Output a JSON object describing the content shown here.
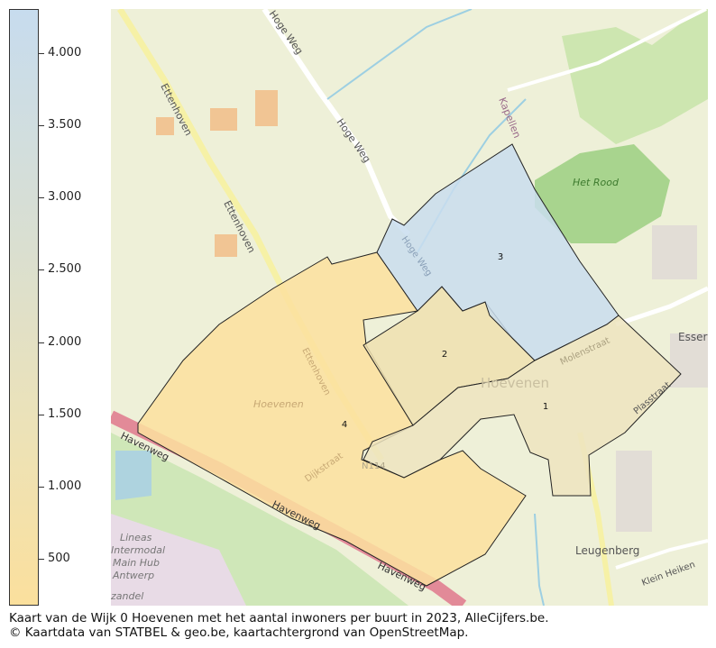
{
  "legend": {
    "colors": {
      "low": "#fbe09d",
      "mid": "#dadfd0",
      "high": "#c7dcee"
    },
    "ticks": [
      "4.000",
      "3.500",
      "3.000",
      "2.500",
      "2.000",
      "1.500",
      "1.000",
      "500"
    ]
  },
  "map": {
    "regions": [
      {
        "label": "1",
        "color": "#ede4c0"
      },
      {
        "label": "2",
        "color": "#efe0b0"
      },
      {
        "label": "3",
        "color": "#c9ddee"
      },
      {
        "label": "4",
        "color": "#fbe19f"
      }
    ],
    "street_labels": {
      "hoge_weg_top": "Hoge Weg",
      "hoge_weg_mid": "Hoge Weg",
      "hoge_weg_region": "Hoge Weg",
      "ettenhoven_1": "Ettenhoven",
      "ettenhoven_2": "Ettenhoven",
      "ettenhoven_3": "Ettenhoven",
      "kapellen": "Kapellen",
      "het_rood": "Het Rood",
      "esser": "Esser",
      "molenstraat": "Molenstraat",
      "plasstraat": "Plasstraat",
      "hoevenen_big": "Hoevenen",
      "hoevenen_small": "Hoevenen",
      "havenweg_1": "Havenweg",
      "havenweg_2": "Havenweg",
      "havenweg_3": "Havenweg",
      "dijkstraat": "Dijkstraat",
      "n114": "N114",
      "leugenberg": "Leugenberg",
      "klein_heiken": "Klein Heiken",
      "lineas": "Lineas",
      "intermodal": "Intermodal",
      "main_hub": "Main Hub",
      "antwerp": "Antwerp",
      "zandel": "zandel"
    }
  },
  "caption": {
    "line1": "Kaart van de Wijk 0 Hoevenen met het aantal inwoners per buurt in 2023, AlleCijfers.be.",
    "line2": "© Kaartdata van STATBEL & geo.be, kaartachtergrond van OpenStreetMap."
  }
}
